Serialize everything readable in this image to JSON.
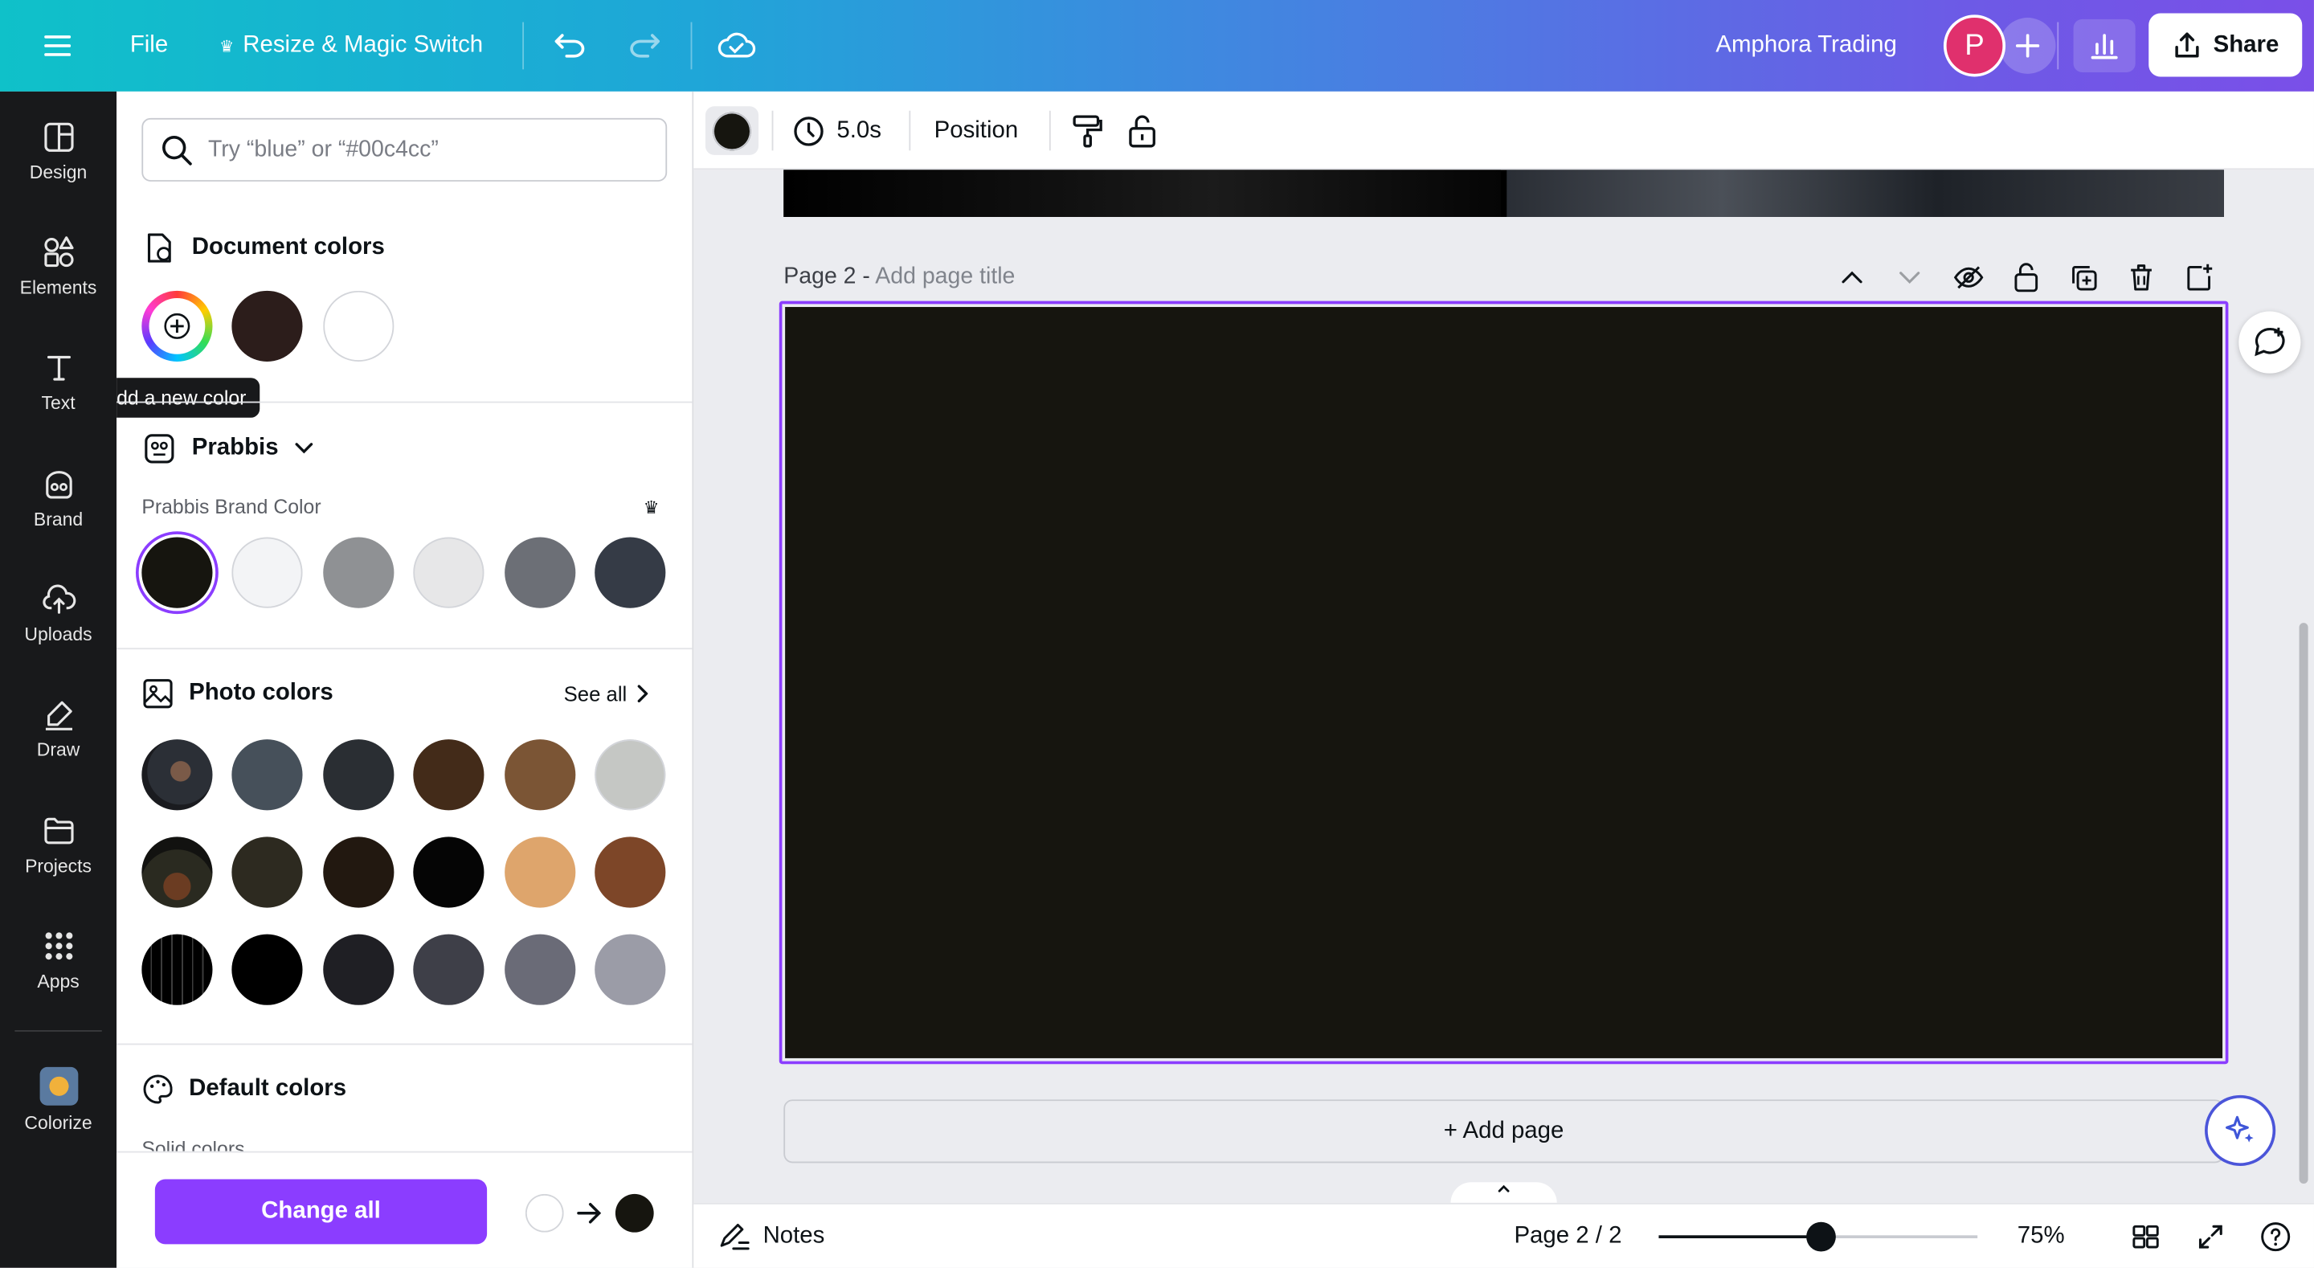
{
  "topbar": {
    "file_label": "File",
    "resize_label": "Resize & Magic Switch",
    "project_name": "Amphora Trading",
    "avatar_letter": "P",
    "share_label": "Share"
  },
  "rail": {
    "items": [
      {
        "label": "Design",
        "icon": "design-icon"
      },
      {
        "label": "Elements",
        "icon": "elements-icon"
      },
      {
        "label": "Text",
        "icon": "text-icon"
      },
      {
        "label": "Brand",
        "icon": "brand-icon"
      },
      {
        "label": "Uploads",
        "icon": "uploads-icon"
      },
      {
        "label": "Draw",
        "icon": "draw-icon"
      },
      {
        "label": "Projects",
        "icon": "projects-icon"
      },
      {
        "label": "Apps",
        "icon": "apps-icon"
      },
      {
        "label": "Colorize",
        "icon": "colorize-icon"
      }
    ]
  },
  "panel": {
    "search_placeholder": "Try “blue” or “#00c4cc”",
    "document_colors_title": "Document colors",
    "add_color_tooltip": "Add a new color",
    "document_colors": [
      "#2c1d1b",
      "#ffffff"
    ],
    "brand_kit_name": "Prabbis",
    "brand_color_label": "Prabbis Brand Color",
    "brand_colors": [
      "#16150f",
      "#f3f4f6",
      "#8f9194",
      "#e7e7e8",
      "#6c6f76",
      "#353b46"
    ],
    "photo_colors_title": "Photo colors",
    "see_all_label": "See all",
    "photo_rows": [
      [
        "#46505a",
        "#2a2e33",
        "#432b19",
        "#7b5535",
        "#c5c7c4"
      ],
      [
        "#2d2a20",
        "#221810",
        "#050505",
        "#dea56c",
        "#7d4628"
      ],
      [
        "#000000",
        "#1f1f24",
        "#3e3f48",
        "#6a6b77",
        "#9b9ca7"
      ]
    ],
    "default_colors_title": "Default colors",
    "solid_colors_label": "Solid colors",
    "change_all_label": "Change all",
    "from_color": "#ffffff",
    "to_color": "#16150f"
  },
  "context_bar": {
    "current_color": "#16150f",
    "duration": "5.0s",
    "position_label": "Position"
  },
  "canvas": {
    "page_label": "Page 2 -",
    "page_title_placeholder": "Add page title",
    "page_background": "#16150f",
    "add_page_label": "+ Add page"
  },
  "bottombar": {
    "notes_label": "Notes",
    "page_indicator": "Page 2 / 2",
    "zoom_fraction": 0.51,
    "zoom_label": "75%"
  },
  "colors": {
    "accent": "#8b3dff"
  }
}
